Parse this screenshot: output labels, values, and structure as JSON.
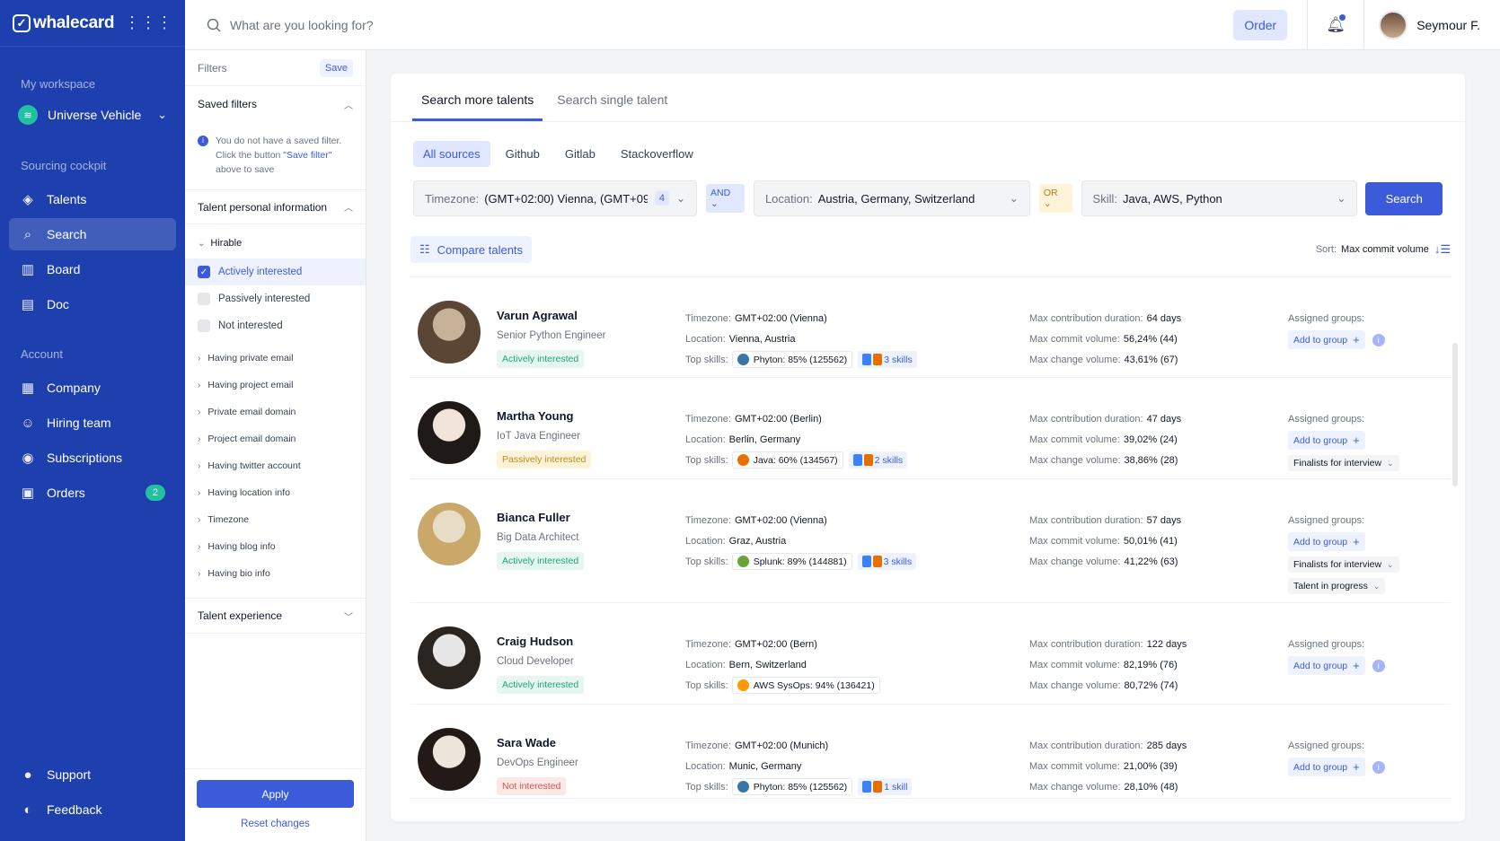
{
  "brand": {
    "name": "whalecard"
  },
  "sidebar": {
    "workspace_label": "My workspace",
    "workspace_name": "Universe Vehicle",
    "sourcing_label": "Sourcing cockpit",
    "sourcing_items": [
      {
        "label": "Talents",
        "icon": "talents-icon"
      },
      {
        "label": "Search",
        "icon": "search-icon"
      },
      {
        "label": "Board",
        "icon": "board-icon"
      },
      {
        "label": "Doc",
        "icon": "doc-icon"
      }
    ],
    "account_label": "Account",
    "account_items": [
      {
        "label": "Company",
        "icon": "company-icon"
      },
      {
        "label": "Hiring team",
        "icon": "team-icon"
      },
      {
        "label": "Subscriptions",
        "icon": "subscriptions-icon"
      },
      {
        "label": "Orders",
        "icon": "orders-icon",
        "badge": "2"
      }
    ],
    "bottom_items": [
      {
        "label": "Support",
        "icon": "support-icon"
      },
      {
        "label": "Feedback",
        "icon": "feedback-icon"
      }
    ]
  },
  "topbar": {
    "search_placeholder": "What are you looking for?",
    "order_label": "Order",
    "user_name": "Seymour F."
  },
  "filters": {
    "title": "Filters",
    "save_label": "Save",
    "saved_filters_title": "Saved filters",
    "saved_note_1": "You do not have a saved filter.",
    "saved_note_2": "Click the button ",
    "saved_note_link": "\"Save filter\"",
    "saved_note_3": "above to save",
    "personal_title": "Talent personal information",
    "hirable_title": "Hirable",
    "hirable_options": [
      {
        "label": "Actively interested",
        "checked": true
      },
      {
        "label": "Passively interested",
        "checked": false
      },
      {
        "label": "Not interested",
        "checked": false
      }
    ],
    "items": [
      "Having private email",
      "Having project email",
      "Private email domain",
      "Project email domain",
      "Having twitter account",
      "Having location info",
      "Timezone",
      "Having blog info",
      "Having bio info"
    ],
    "experience_title": "Talent experience",
    "apply_label": "Apply",
    "reset_label": "Reset changes"
  },
  "main": {
    "tabs": [
      "Search more talents",
      "Search single talent"
    ],
    "sources": [
      "All sources",
      "Github",
      "Gitlab",
      "Stackoverflow"
    ],
    "query": {
      "timezone_label": "Timezone:",
      "timezone_value": "(GMT+02:00) Vienna, (GMT+09...",
      "timezone_count": "4",
      "op1": "AND",
      "location_label": "Location:",
      "location_value": "Austria, Germany, Switzerland",
      "op2": "OR",
      "skill_label": "Skill:",
      "skill_value": "Java, AWS, Python",
      "search_label": "Search"
    },
    "compare_label": "Compare talents",
    "sort_label": "Sort:",
    "sort_value": "Max commit volume",
    "field_labels": {
      "timezone": "Timezone:",
      "location": "Location:",
      "skills": "Top skills:",
      "duration": "Max contribution duration:",
      "commit": "Max commit volume:",
      "change": "Max change volume:",
      "groups": "Assigned groups:",
      "add_group": "Add to group"
    },
    "talents": [
      {
        "name": "Varun Agrawal",
        "role": "Senior Python Engineer",
        "status": "Actively interested",
        "status_type": "active",
        "timezone": "GMT+02:00 (Vienna)",
        "location": "Vienna, Austria",
        "top_skill": "Phyton: 85% (125562)",
        "skill_color": "#3776ab",
        "more_skills": "3 skills",
        "duration": "64 days",
        "commit": "56,24% (44)",
        "change": "43,61% (67)",
        "groups": [],
        "avatar_colors": [
          "#c7b299",
          "#5b4636"
        ]
      },
      {
        "name": "Martha Young",
        "role": "IoT Java Engineer",
        "status": "Passively interested",
        "status_type": "passive",
        "timezone": "GMT+02:00 (Berlin)",
        "location": "Berlin, Germany",
        "top_skill": "Java: 60% (134567)",
        "skill_color": "#e76f00",
        "more_skills": "2 skills",
        "duration": "47 days",
        "commit": "39,02% (24)",
        "change": "38,86% (28)",
        "groups": [
          "Finalists for interview"
        ],
        "avatar_colors": [
          "#f2e4d8",
          "#1f1a17"
        ]
      },
      {
        "name": "Bianca Fuller",
        "role": "Big Data Architect",
        "status": "Actively interested",
        "status_type": "active",
        "timezone": "GMT+02:00 (Vienna)",
        "location": "Graz, Austria",
        "top_skill": "Splunk: 89% (144881)",
        "skill_color": "#65a637",
        "more_skills": "3 skills",
        "duration": "57 days",
        "commit": "50,01% (41)",
        "change": "41,22% (63)",
        "groups": [
          "Finalists for interview",
          "Talent in progress"
        ],
        "avatar_colors": [
          "#e9dcc6",
          "#c9a86a"
        ]
      },
      {
        "name": "Craig Hudson",
        "role": "Cloud Developer",
        "status": "Actively interested",
        "status_type": "active",
        "timezone": "GMT+02:00 (Bern)",
        "location": "Bern, Switzerland",
        "top_skill": "AWS SysOps: 94% (136421)",
        "skill_color": "#ff9900",
        "more_skills": "",
        "duration": "122 days",
        "commit": "82,19% (76)",
        "change": "80,72% (74)",
        "groups": [],
        "avatar_colors": [
          "#e6e6e6",
          "#2b2522"
        ]
      },
      {
        "name": "Sara Wade",
        "role": "DevOps Engineer",
        "status": "Not interested",
        "status_type": "not",
        "timezone": "GMT+02:00 (Munich)",
        "location": "Munic, Germany",
        "top_skill": "Phyton: 85% (125562)",
        "skill_color": "#3776ab",
        "more_skills": "1 skill",
        "duration": "285 days",
        "commit": "21,00% (39)",
        "change": "28,10% (48)",
        "groups": [],
        "avatar_colors": [
          "#ede4dc",
          "#231a17"
        ]
      }
    ]
  },
  "colors": {
    "sidebar": "#1e40af",
    "accent": "#3b5bdb",
    "success": "#1fa57a",
    "warning": "#c08a1a",
    "danger": "#d9534f"
  }
}
